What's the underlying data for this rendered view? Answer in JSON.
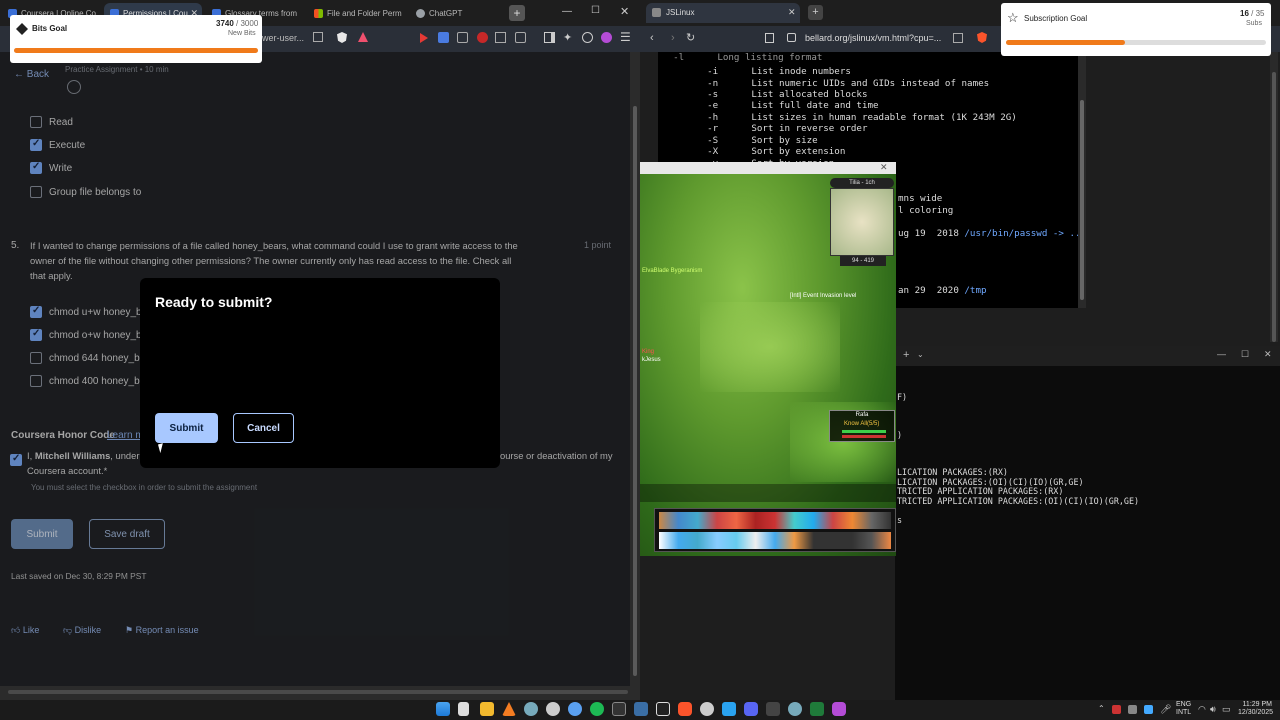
{
  "left_browser": {
    "tabs": [
      {
        "label": "Coursera | Online Co",
        "active": false
      },
      {
        "label": "Permissions | Cou",
        "active": true
      },
      {
        "label": "Glossary terms from",
        "active": false
      },
      {
        "label": "File and Folder Perm",
        "active": false
      },
      {
        "label": "ChatGPT",
        "active": false
      }
    ],
    "address_partial": "wer-user...",
    "back_label": "Back",
    "assignment_meta": "Practice Assignment • 10 min",
    "q4_options": [
      {
        "label": "Read",
        "checked": false
      },
      {
        "label": "Execute",
        "checked": true
      },
      {
        "label": "Write",
        "checked": true
      },
      {
        "label": "Group file belongs to",
        "checked": false
      }
    ],
    "q5_number": "5.",
    "q5_text_1": "If I wanted to change permissions of a file called honey_bears, what command could I use to grant write access to the",
    "q5_text_2": "owner of the file without changing other permissions? The owner currently only has read access to the file. Check all",
    "q5_text_3": "that apply.",
    "q5_points": "1 point",
    "q5_options": [
      {
        "label": "chmod u+w honey_be",
        "checked": true
      },
      {
        "label": "chmod o+w honey_be",
        "checked": true
      },
      {
        "label": "chmod 644 honey_be",
        "checked": false
      },
      {
        "label": "chmod 400 honey_be",
        "checked": false
      }
    ],
    "honor_title": "Coursera Honor Code",
    "honor_link": "Learn m",
    "honor_text_pre": "I, ",
    "honor_name": "Mitchell Williams",
    "honor_text_mid": ", under",
    "honor_text_right": "ourse or deactivation of my",
    "honor_text_2": "Coursera account.*",
    "honor_warning": "You must select the checkbox in order to submit the assignment",
    "submit_label": "Submit",
    "save_draft_label": "Save draft",
    "last_saved": "Last saved on Dec 30, 8:29 PM PST",
    "like_label": "Like",
    "dislike_label": "Dislike",
    "report_label": "Report an issue"
  },
  "modal": {
    "title": "Ready to submit?",
    "submit_label": "Submit",
    "cancel_label": "Cancel"
  },
  "right_browser": {
    "tab_label": "JSLinux",
    "address": "bellard.org/jslinux/vm.html?cpu=..."
  },
  "terminal_lines": [
    "  -i      List inode numbers",
    "  -n      List numeric UIDs and GIDs instead of names",
    "  -s      List allocated blocks",
    "  -e      List full date and time",
    "  -h      List sizes in human readable format (1K 243M 2G)",
    "  -r      Sort in reverse order",
    "  -S      Sort by size",
    "  -X      Sort by extension",
    "  -v      Sort by version"
  ],
  "terminal_partial": {
    "line_wide": "mns wide",
    "line_color": "l coloring",
    "line_passwd_date": "ug 19  2018 ",
    "line_passwd_path": "/usr/bin/passwd -> ../.",
    "line_tmp_date": "an 29  2020 ",
    "line_tmp_path": "/tmp"
  },
  "cmd_lines": [
    "F)",
    ")",
    "LICATION PACKAGES:(RX)",
    "LICATION PACKAGES:(OI)(CI)(IO)(GR,GE)",
    "TRICTED APPLICATION PACKAGES:(RX)",
    "TRICTED APPLICATION PACKAGES:(OI)(CI)(IO)(GR,GE)",
    "s"
  ],
  "game": {
    "minimap_title": "Tilia - 1ch",
    "coords": "94 - 419",
    "event_text": "[Intl] Event Invasion level",
    "npc_name": "Rafa",
    "npc_title": "Know All(5/5)",
    "enemy_label": "King",
    "enemy_sub": "kJesus",
    "player_name_overlay": "ElvaBlade Bygeranism"
  },
  "bits_goal": {
    "title": "Bits Goal",
    "current": "3740",
    "target": "/ 3000",
    "sub": "New Bits",
    "progress": 1.0
  },
  "subs_goal": {
    "title": "Subscription Goal",
    "current": "16",
    "target": "/ 35",
    "sub": "Subs",
    "progress": 0.457
  },
  "systray": {
    "lang": "ENG",
    "lang2": "INTL",
    "time": "11:29 PM",
    "date": "12/30/2025"
  },
  "colors": {
    "accent_blue": "#7fb0ff",
    "progress_orange": "#f07a1a"
  }
}
